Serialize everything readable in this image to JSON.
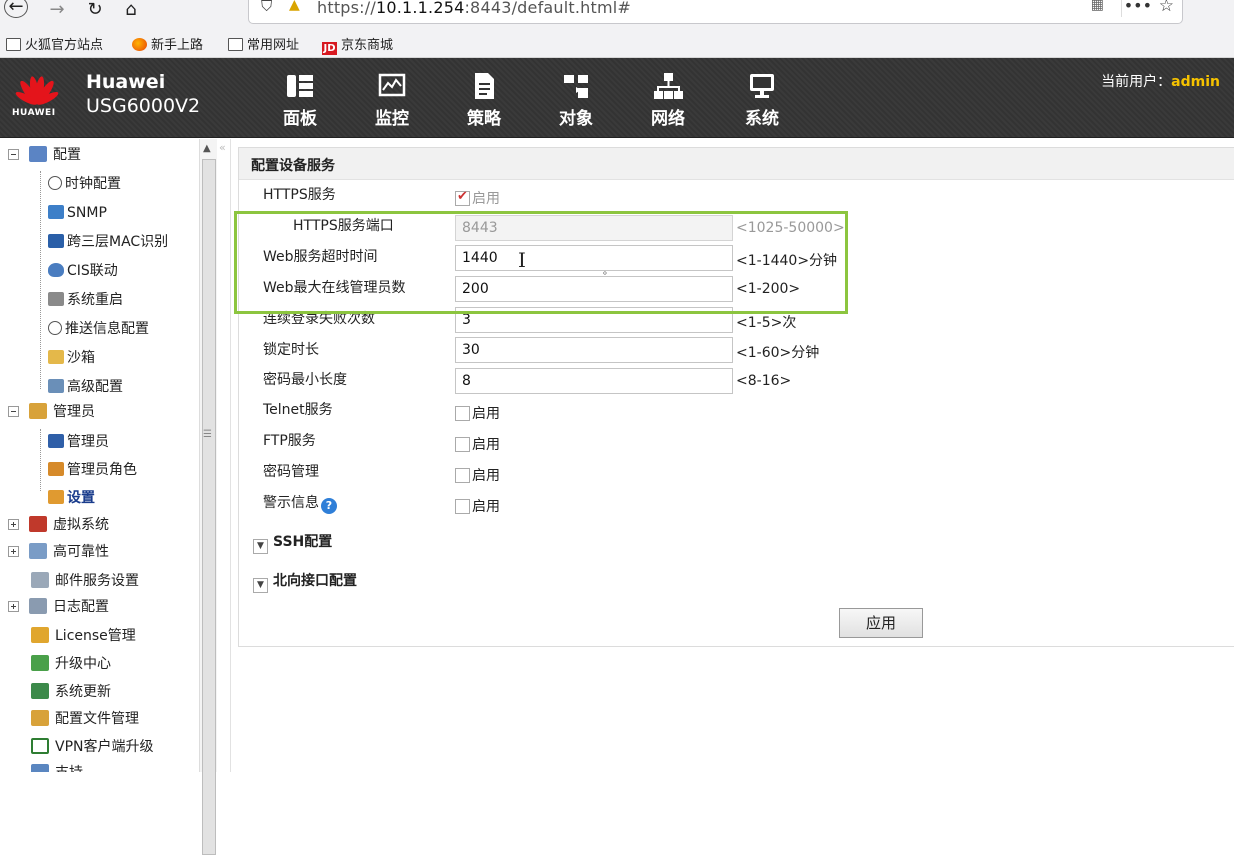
{
  "browser": {
    "url_prefix": "https://",
    "url_host": "10.1.1.254",
    "url_rest": ":8443/default.html#",
    "back_icon": "arrow-left-icon",
    "forward_icon": "arrow-right-icon",
    "reload_icon": "reload-icon",
    "home_icon": "home-icon",
    "bookmarks": [
      {
        "label": "火狐官方站点",
        "icon": "folder-icon"
      },
      {
        "label": "新手上路",
        "icon": "firefox-icon"
      },
      {
        "label": "常用网址",
        "icon": "folder-icon"
      },
      {
        "label": "京东商城",
        "icon": "jd-icon"
      }
    ]
  },
  "header": {
    "brand_name": "Huawei",
    "brand_model": "USG6000V2",
    "logo_text": "HUAWEI",
    "current_user_label": "当前用户：",
    "current_user": "admin",
    "menu": [
      {
        "label": "面板",
        "icon": "dashboard-icon"
      },
      {
        "label": "监控",
        "icon": "monitor-icon"
      },
      {
        "label": "策略",
        "icon": "policy-icon"
      },
      {
        "label": "对象",
        "icon": "object-icon"
      },
      {
        "label": "网络",
        "icon": "network-icon"
      },
      {
        "label": "系统",
        "icon": "system-icon"
      }
    ]
  },
  "sidebar": {
    "group_config": "配置",
    "config_items": [
      "时钟配置",
      "SNMP",
      "跨三层MAC识别",
      "CIS联动",
      "系统重启",
      "推送信息配置",
      "沙箱",
      "高级配置"
    ],
    "group_admin": "管理员",
    "admin_items": [
      "管理员",
      "管理员角色",
      "设置"
    ],
    "other_items": [
      "虚拟系统",
      "高可靠性",
      "邮件服务设置",
      "日志配置",
      "License管理",
      "升级中心",
      "系统更新",
      "配置文件管理",
      "VPN客户端升级",
      "支持"
    ]
  },
  "form": {
    "title": "配置设备服务",
    "https_service_label": "HTTPS服务",
    "https_enable_label": "启用",
    "https_port_label": "HTTPS服务端口",
    "https_port_value": "8443",
    "https_port_range": "<1025-50000>",
    "timeout_label": "Web服务超时时间",
    "timeout_value": "1440",
    "timeout_range": "<1-1440>分钟",
    "max_admin_label": "Web最大在线管理员数",
    "max_admin_value": "200",
    "max_admin_range": "<1-200>",
    "login_fail_label": "连续登录失败次数",
    "login_fail_value": "3",
    "login_fail_range": "<1-5>次",
    "lock_label": "锁定时长",
    "lock_value": "30",
    "lock_range": "<1-60>分钟",
    "pwd_min_label": "密码最小长度",
    "pwd_min_value": "8",
    "pwd_min_range": "<8-16>",
    "telnet_label": "Telnet服务",
    "ftp_label": "FTP服务",
    "pwd_mgmt_label": "密码管理",
    "warn_label": "警示信息",
    "enable_label": "启用",
    "ssh_section": "SSH配置",
    "northbound_section": "北向接口配置",
    "apply_label": "应用"
  },
  "colors": {
    "highlight": "#8cc53f",
    "user_name": "#f5c200",
    "header_bg": "#363636"
  }
}
